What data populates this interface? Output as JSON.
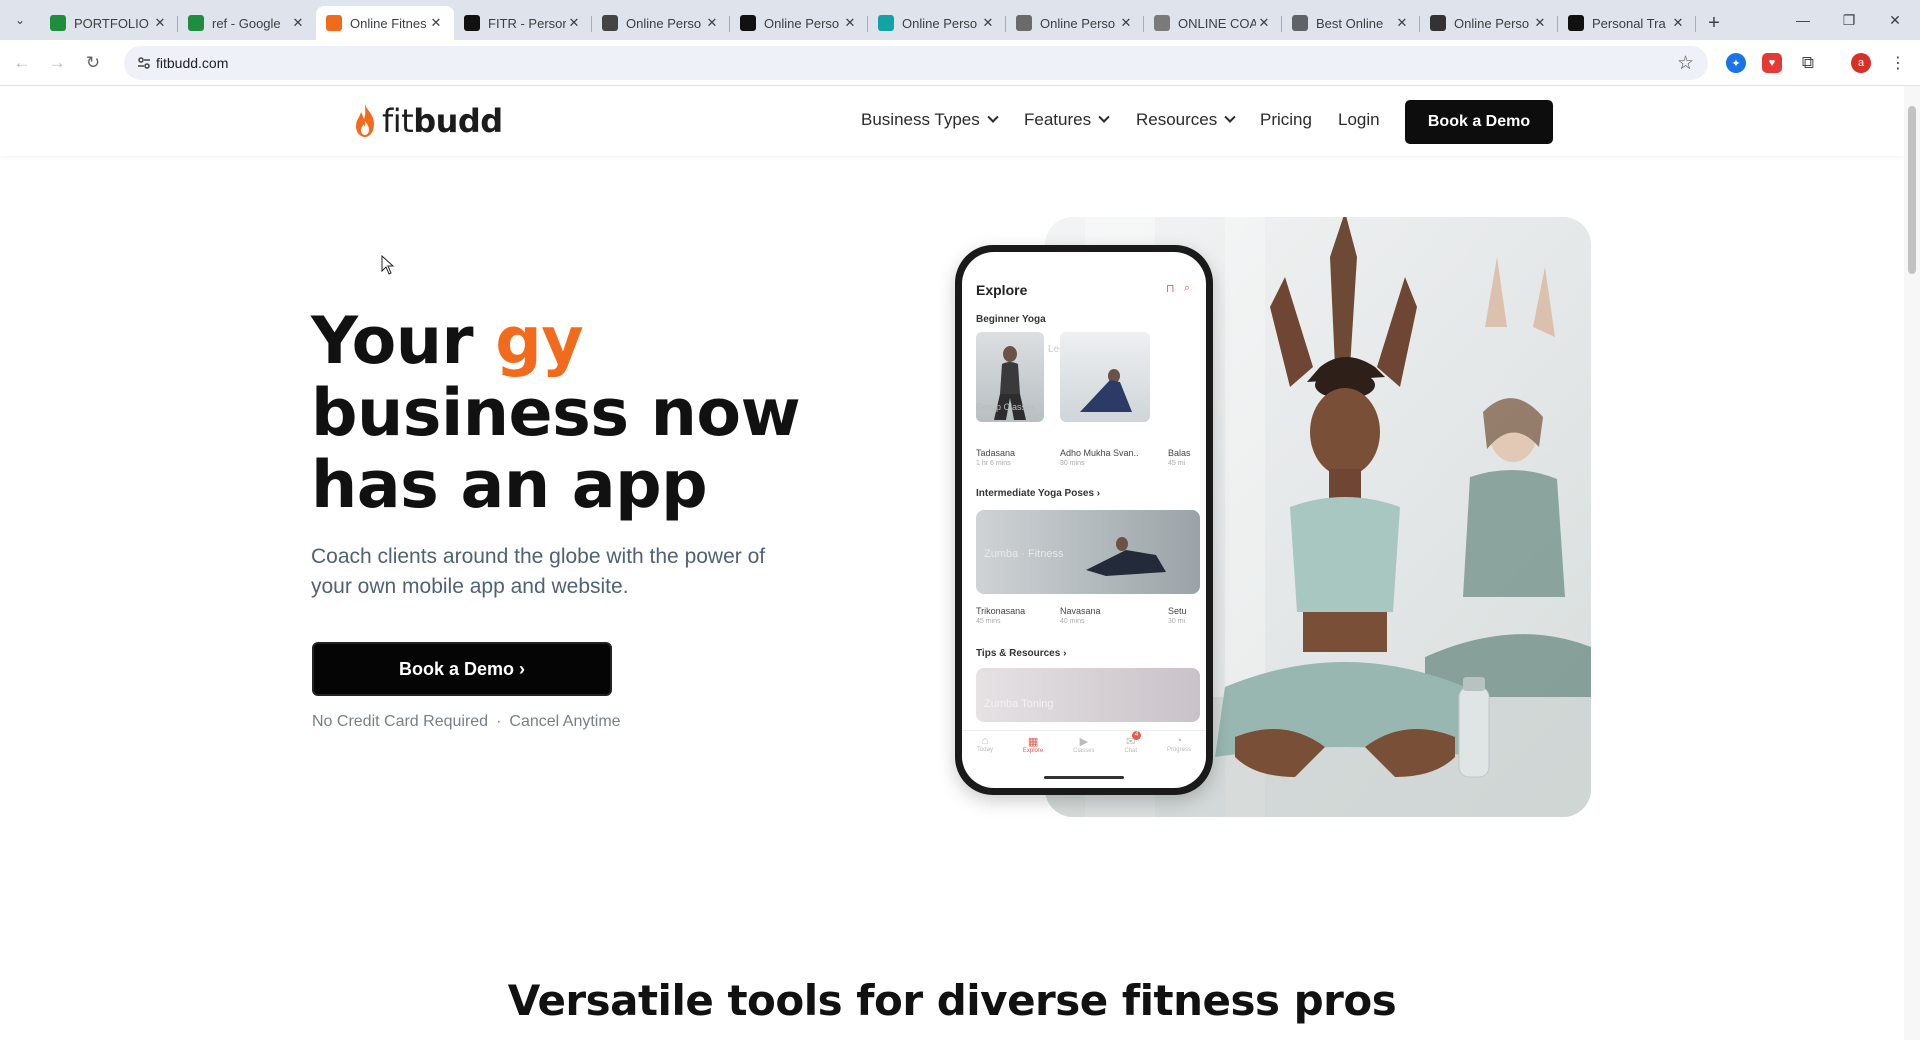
{
  "browser": {
    "tabs": [
      {
        "title": "PORTFOLIO",
        "icon": "sheets-icon",
        "color": "#1e8e3e"
      },
      {
        "title": "ref - Google",
        "icon": "sheets-icon",
        "color": "#1e8e3e"
      },
      {
        "title": "Online Fitnes",
        "icon": "fitbudd-flame-icon",
        "color": "#f26b1d",
        "active": true
      },
      {
        "title": "FITR - Persor",
        "icon": "fitr-icon",
        "color": "#111111"
      },
      {
        "title": "Online Perso",
        "icon": "cube-icon",
        "color": "#444444"
      },
      {
        "title": "Online Perso",
        "icon": "k-icon",
        "color": "#111111"
      },
      {
        "title": "Online Perso",
        "icon": "chart-icon",
        "color": "#12a4a4"
      },
      {
        "title": "Online Perso",
        "icon": "spiral-icon",
        "color": "#6a6a6a"
      },
      {
        "title": "ONLINE COA",
        "icon": "coach-icon",
        "color": "#7a7a7a"
      },
      {
        "title": "Best Online",
        "icon": "globe-icon",
        "color": "#5f6368"
      },
      {
        "title": "Online Perso",
        "icon": "mountain-icon",
        "color": "#333333"
      },
      {
        "title": "Personal Tra",
        "icon": "fs-icon",
        "color": "#111111"
      }
    ],
    "url": "fitbudd.com",
    "profile_initial": "a"
  },
  "header": {
    "logo_prefix": "fit",
    "logo_suffix": "budd",
    "nav": [
      "Business Types",
      "Features",
      "Resources",
      "Pricing",
      "Login"
    ],
    "cta": "Book a Demo"
  },
  "hero": {
    "title_line1_a": "Your ",
    "title_line1_b": "gy",
    "title_line2": "business now",
    "title_line3": "has an app",
    "subtitle": "Coach clients around the globe with the power of your own mobile app and website.",
    "cta": "Book a Demo ›",
    "note_a": "No Credit Card Required",
    "note_sep": "·",
    "note_b": "Cancel Anytime"
  },
  "phone": {
    "header": "Explore",
    "section1": "Beginner Yoga",
    "faded1": "Leslie Alexand",
    "faded2": "Group Classes",
    "items1": [
      {
        "name": "Tadasana",
        "dur": "1 hr 6 mins"
      },
      {
        "name": "Adho Mukha Svan..",
        "dur": "30 mins"
      },
      {
        "name": "Balas",
        "dur": "45 mi"
      }
    ],
    "section2": "Intermediate Yoga Poses ›",
    "faded3": "Zumba · Fitness",
    "items2": [
      {
        "name": "Trikonasana",
        "dur": "45 mins"
      },
      {
        "name": "Navasana",
        "dur": "40 mins"
      },
      {
        "name": "Setu",
        "dur": "30 mi"
      }
    ],
    "section3": "Tips & Resources ›",
    "faded4": "Zumba Toning",
    "tabbar": [
      "Today",
      "Explore",
      "Classes",
      "Chat",
      "Progress"
    ],
    "chat_badge": "4"
  },
  "section2": {
    "title": "Versatile tools for diverse fitness pros"
  },
  "colors": {
    "accent": "#f26b1d",
    "dark": "#0d0d0d",
    "subtext": "#4f6275"
  }
}
